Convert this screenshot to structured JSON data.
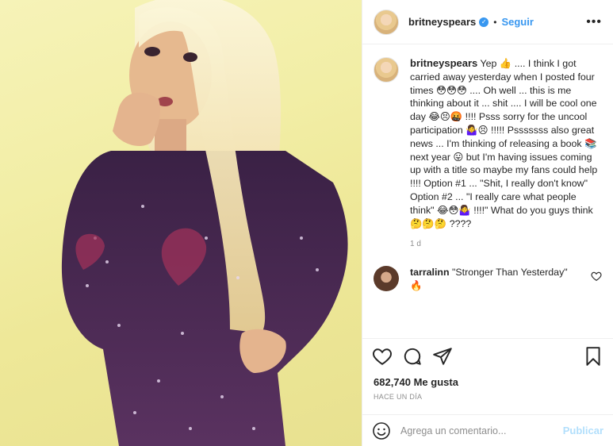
{
  "post": {
    "username": "britneyspears",
    "verified_badge": "✓",
    "follow_label": "Seguir",
    "dot": "•",
    "more_label": "•••"
  },
  "caption": {
    "username": "britneyspears",
    "text": " Yep 👍 .... I think I got carried away yesterday when I posted four times 😳😳😳 .... Oh well ... this is me thinking about it ... shit .... I will be cool one day 😂😣🤬 !!!! Psss sorry for the uncool participation 🤷‍♀️😣 !!!!! Psssssss also great news ... I'm thinking of releasing a book 📚 next year 😛 but I'm having issues coming up with a title so maybe my fans could help !!!! Option #1 ... \"Shit, I really don't know\" Option #2 ... \"I really care what people think\" 😂😳🤷‍♀️ !!!!\" What do you guys think 🤔🤔🤔 ????",
    "time": "1 d"
  },
  "comment": {
    "username": "tarralinn",
    "text": " \"Stronger Than Yesterday\" 🔥"
  },
  "stats": {
    "likes": "682,740 Me gusta",
    "ago": "HACE UN DÍA"
  },
  "add_comment": {
    "placeholder": "Agrega un comentario...",
    "post_label": "Publicar"
  },
  "colors": {
    "link_blue": "#3897f0",
    "publish_disabled": "#b2dffc",
    "photo_background": "#f2eea6"
  },
  "icons": [
    "heart-icon",
    "comment-icon",
    "share-icon",
    "save-icon",
    "emoji-icon",
    "more-icon",
    "verified-icon"
  ]
}
